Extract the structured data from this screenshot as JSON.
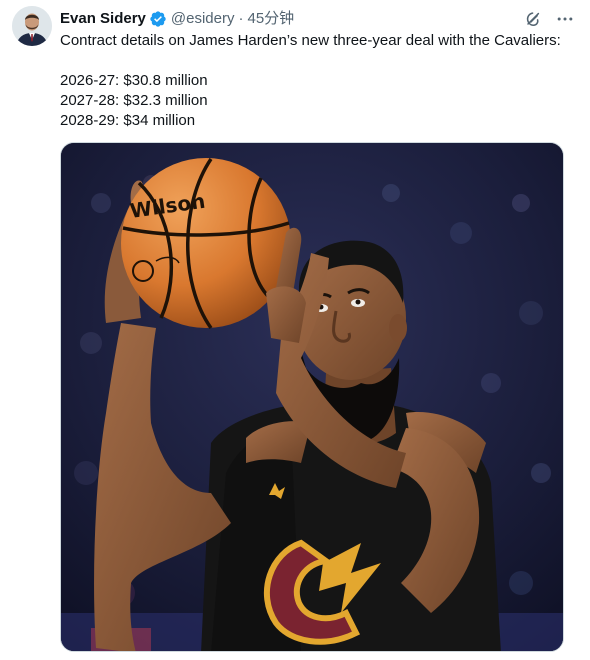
{
  "author": {
    "name": "Evan Sidery",
    "handle": "@esidery",
    "separator": "·",
    "time": "45分钟",
    "verified_color": "#1d9bf0",
    "verified_icon": "verified-badge-icon",
    "avatar_icon": "avatar-portrait"
  },
  "tweet": {
    "text_lines": [
      "Contract details on James Harden’s new three-year deal with the Cavaliers:",
      "",
      "2026-27: $30.8 million",
      "2027-28: $32.3 million",
      "2028-29: $34 million"
    ]
  },
  "actions": {
    "grok_icon": "grok-icon",
    "more_icon": "more-dots-icon"
  },
  "media": {
    "description_icon": "basketball-player-photo",
    "ball_brand_text": "Wilson",
    "colors": {
      "background": "#1a1d3a",
      "jersey": "#151515",
      "jersey_wine": "#7a2330",
      "jersey_gold": "#e3a72f",
      "ball": "#d9782f",
      "skin": "#8a5a3b"
    }
  }
}
